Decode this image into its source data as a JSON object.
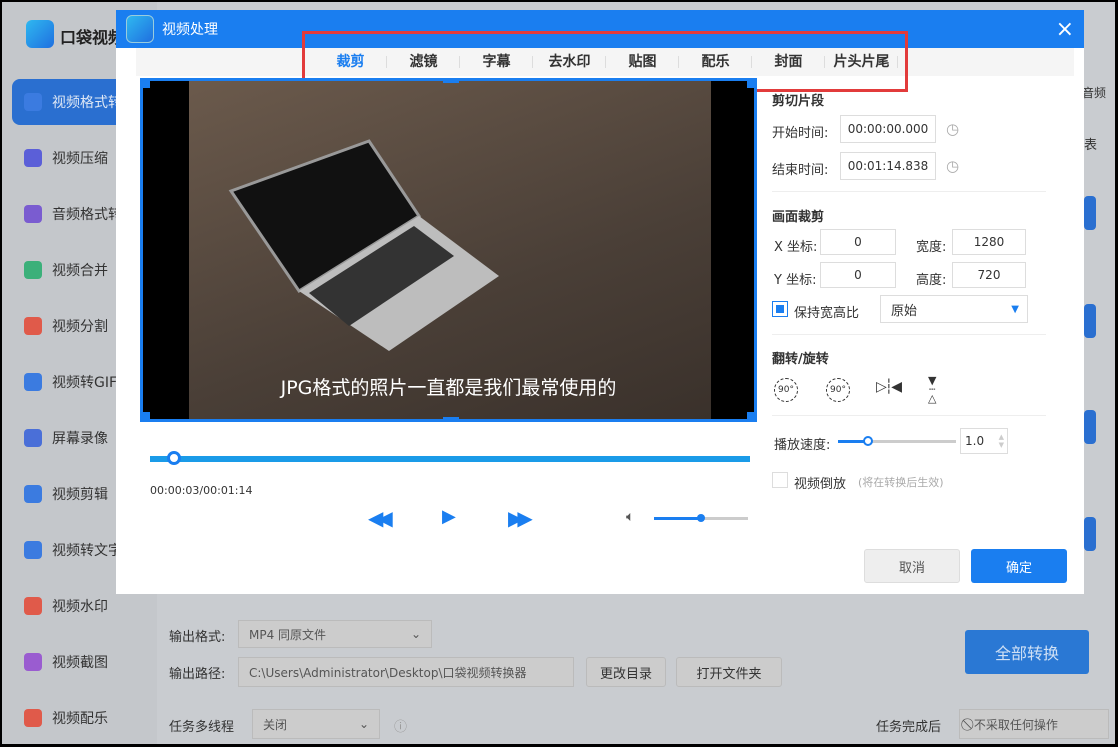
{
  "app": {
    "name": "口袋视频",
    "sidebar": [
      "视频格式转",
      "视频压缩",
      "音频格式转",
      "视频合并",
      "视频分割",
      "视频转GIF",
      "屏幕录像",
      "视频剪辑",
      "视频转文字",
      "视频水印",
      "视频截图",
      "视频配乐"
    ],
    "right_peek": {
      "audio": "音频",
      "list": "表"
    }
  },
  "dialog": {
    "title": "视频处理",
    "close": "×",
    "tabs": [
      "裁剪",
      "滤镜",
      "字幕",
      "去水印",
      "贴图",
      "配乐",
      "封面",
      "片头片尾"
    ],
    "subtitle": "JPG格式的照片一直都是我们最常使用的",
    "time_readout": "00:00:03/00:01:14",
    "playback_progress": 0.04,
    "volume": 0.5,
    "cut": {
      "header": "剪切片段",
      "start_label": "开始时间:",
      "start": "00:00:00.000",
      "end_label": "结束时间:",
      "end": "00:01:14.838"
    },
    "crop": {
      "header": "画面裁剪",
      "x_label": "X 坐标:",
      "x": "0",
      "y_label": "Y 坐标:",
      "y": "0",
      "w_label": "宽度:",
      "w": "1280",
      "h_label": "高度:",
      "h": "720",
      "keep_label": "保持宽高比",
      "ratio": "原始"
    },
    "rotate": {
      "header": "翻转/旋转",
      "r1": "90°",
      "r2": "90°"
    },
    "speed": {
      "label": "播放速度:",
      "value": "1.0",
      "fraction": 0.25
    },
    "reverse": {
      "label": "视频倒放",
      "hint": "(将在转换后生效)"
    },
    "cancel": "取消",
    "ok": "确定"
  },
  "bottom": {
    "format_label": "输出格式:",
    "format": "MP4  同原文件",
    "path_label": "输出路径:",
    "path": "C:\\Users\\Administrator\\Desktop\\口袋视频转换器",
    "change_dir": "更改目录",
    "open_folder": "打开文件夹",
    "convert_all": "全部转换",
    "thread_label": "任务多线程",
    "thread": "关闭",
    "after_label": "任务完成后",
    "after": "不采取任何操作"
  }
}
